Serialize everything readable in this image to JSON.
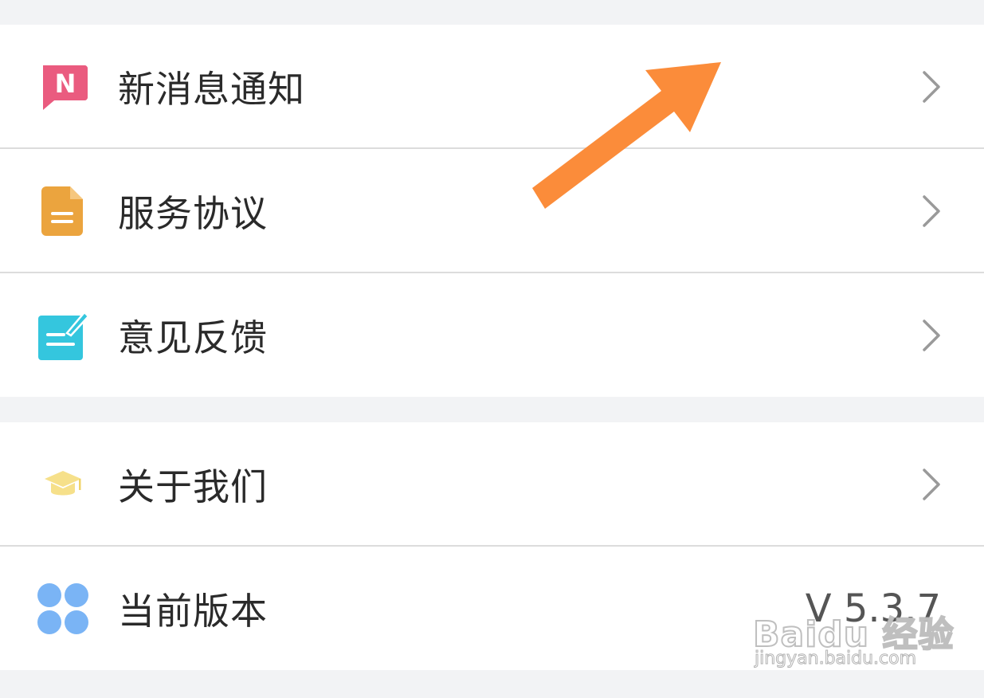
{
  "settings": {
    "items": [
      {
        "label": "新消息通知",
        "icon": "message-n-icon"
      },
      {
        "label": "服务协议",
        "icon": "document-icon"
      },
      {
        "label": "意见反馈",
        "icon": "edit-note-icon"
      },
      {
        "label": "关于我们",
        "icon": "graduation-cap-icon"
      },
      {
        "label": "当前版本",
        "icon": "four-dots-icon",
        "value": "V 5.3.7"
      }
    ]
  },
  "colors": {
    "background": "#f2f3f5",
    "row_background": "#ffffff",
    "divider": "#dcdcdc",
    "text": "#2a2a2a",
    "chevron": "#9a9a9a",
    "annotation_arrow": "#fb8c3a",
    "icon_notification": "#ea5b7f",
    "icon_agreement": "#eba43e",
    "icon_feedback": "#34c6de",
    "icon_about": "#f6e08a",
    "icon_version": "#7ab4f5"
  },
  "watermark": {
    "brand": "Baidu 经验",
    "site": "jingyan.baidu.com"
  }
}
